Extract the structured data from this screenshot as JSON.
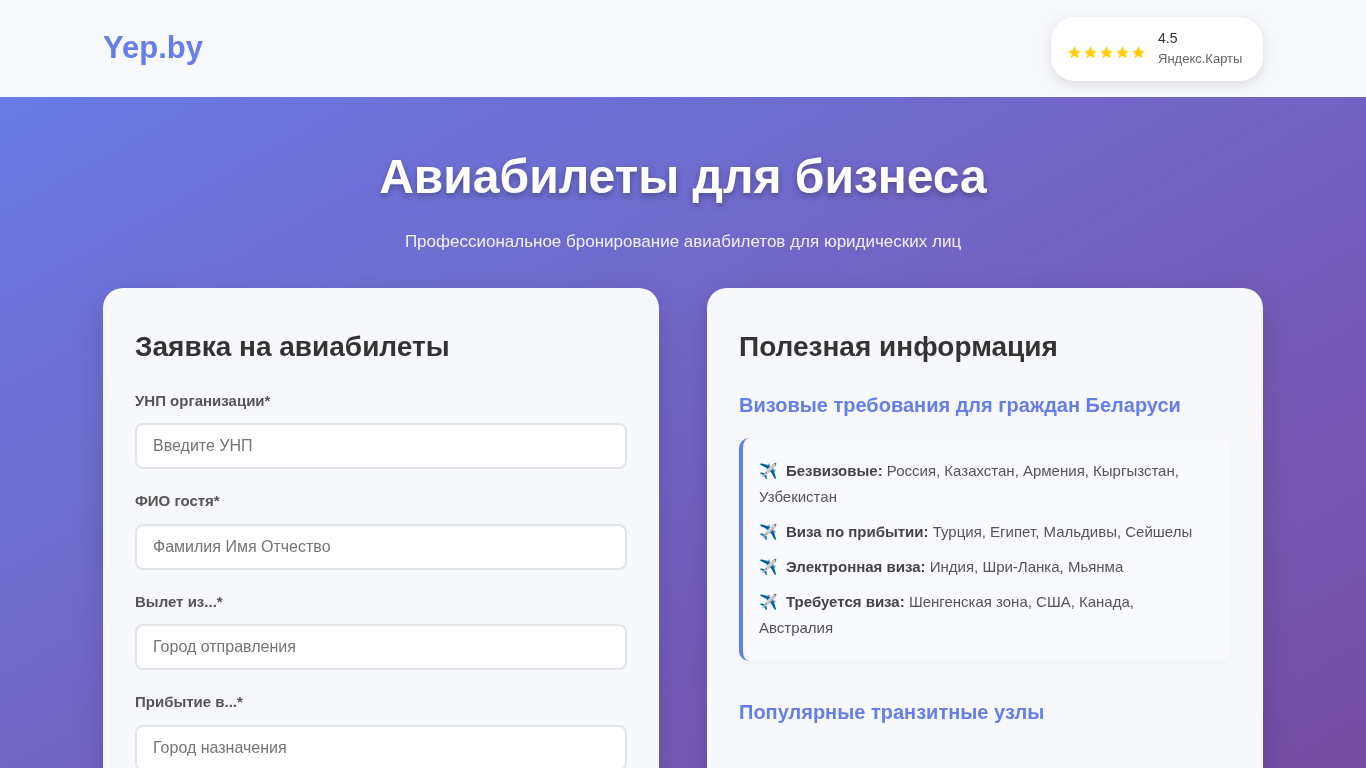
{
  "header": {
    "logo": "Yep.by",
    "rating": {
      "stars": 5,
      "score": "4.5",
      "source": "Яндекс.Карты"
    }
  },
  "hero": {
    "title": "Авиабилеты для бизнеса",
    "subtitle": "Профессиональное бронирование авиабилетов для юридических лиц"
  },
  "form": {
    "title": "Заявка на авиабилеты",
    "fields": [
      {
        "label": "УНП организации*",
        "placeholder": "Введите УНП"
      },
      {
        "label": "ФИО гостя*",
        "placeholder": "Фамилия Имя Отчество"
      },
      {
        "label": "Вылет из...*",
        "placeholder": "Город отправления"
      },
      {
        "label": "Прибытие в...*",
        "placeholder": "Город назначения"
      }
    ]
  },
  "info": {
    "title": "Полезная информация",
    "sections": [
      {
        "title": "Визовые требования для граждан Беларуси",
        "items": [
          {
            "icon": "✈️",
            "label": "Безвизовые:",
            "text": "Россия, Казахстан, Армения, Кыргызстан, Узбекистан"
          },
          {
            "icon": "✈️",
            "label": "Виза по прибытии:",
            "text": "Турция, Египет, Мальдивы, Сейшелы"
          },
          {
            "icon": "✈️",
            "label": "Электронная виза:",
            "text": "Индия, Шри-Ланка, Мьянма"
          },
          {
            "icon": "✈️",
            "label": "Требуется виза:",
            "text": "Шенгенская зона, США, Канада, Австралия"
          }
        ]
      },
      {
        "title": "Популярные транзитные узлы"
      }
    ]
  }
}
